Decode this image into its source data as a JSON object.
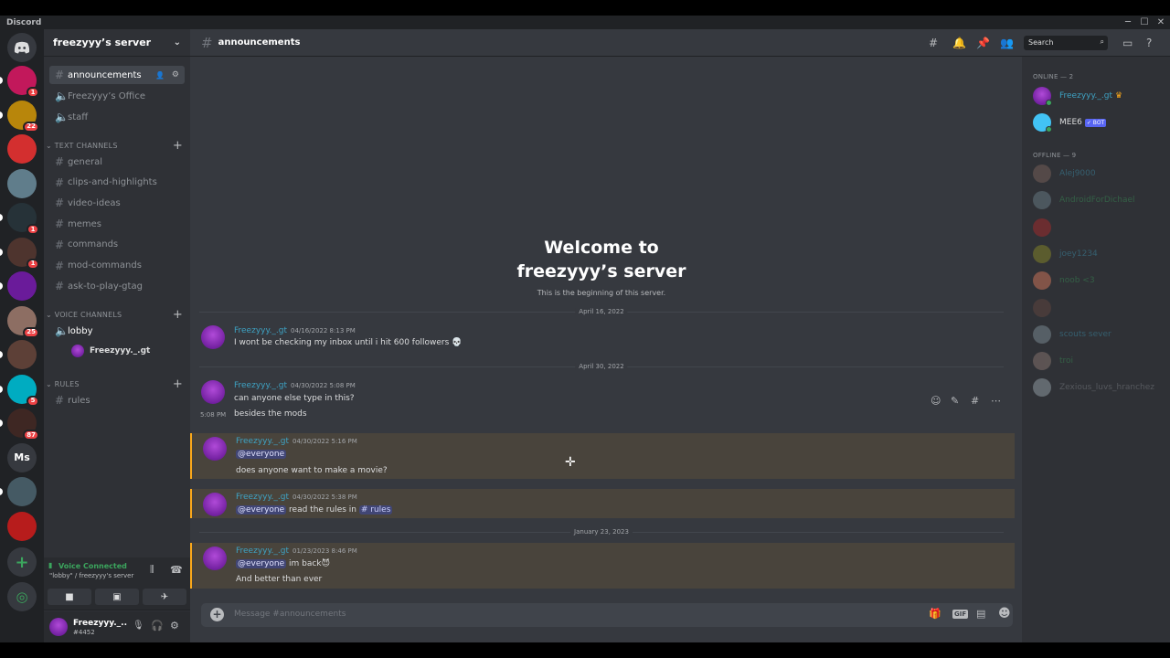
{
  "app": {
    "title": "Discord"
  },
  "server": {
    "name": "freezyyy’s server"
  },
  "guilds": [
    {
      "badge": "1"
    },
    {
      "badge": "22"
    },
    {
      "badge": ""
    },
    {
      "badge": ""
    },
    {
      "badge": "1"
    },
    {
      "badge": "1"
    },
    {
      "badge": ""
    },
    {
      "badge": "25"
    },
    {
      "badge": ""
    },
    {
      "badge": "5"
    },
    {
      "badge": "87"
    },
    {
      "label": "Ms",
      "badge": ""
    },
    {
      "badge": ""
    },
    {
      "badge": ""
    }
  ],
  "sidebar": {
    "top_channels": [
      {
        "name": "announcements",
        "type": "text"
      },
      {
        "name": "Freezyyy’s Office",
        "type": "voice"
      },
      {
        "name": "staff",
        "type": "voice"
      }
    ],
    "text_category": "TEXT CHANNELS",
    "text_channels": [
      "general",
      "clips-and-highlights",
      "video-ideas",
      "memes",
      "commands",
      "mod-commands",
      "ask-to-play-gtag"
    ],
    "voice_category": "VOICE CHANNELS",
    "voice_channels": [
      {
        "name": "lobby",
        "users": [
          "Freezyyy._.gt"
        ]
      }
    ],
    "rules_category": "RULES",
    "rules_channels": [
      "rules"
    ]
  },
  "voice_panel": {
    "status": "Voice Connected",
    "location": "\"lobby\" / freezyyy's server"
  },
  "user_panel": {
    "name": "Freezyyy._..",
    "tag": "#4452"
  },
  "channel": {
    "name": "announcements"
  },
  "header": {
    "search_placeholder": "Search"
  },
  "welcome": {
    "title_line1": "Welcome to",
    "title_line2": "freezyyy’s server",
    "subtitle": "This is the beginning of this server."
  },
  "dividers": [
    "April 16, 2022",
    "April 30, 2022",
    "January 23, 2023"
  ],
  "messages": [
    {
      "author": "Freezyyy._.gt",
      "timestamp": "04/16/2022 8:13 PM",
      "lines": [
        "I wont be checking my inbox until i hit 600 followers 💀"
      ]
    },
    {
      "author": "Freezyyy._.gt",
      "timestamp": "04/30/2022 5:08 PM",
      "lines": [
        "can anyone else type in this?",
        "besides the mods"
      ],
      "followup_time": "5:08 PM"
    },
    {
      "author": "Freezyyy._.gt",
      "timestamp": "04/30/2022 5:16 PM",
      "mention": "@everyone",
      "lines": [
        "does anyone want to make a movie?"
      ]
    },
    {
      "author": "Freezyyy._.gt",
      "timestamp": "04/30/2022 5:38 PM",
      "mention": "@everyone",
      "text_after": " read the rules in ",
      "channel_link": "# rules"
    },
    {
      "author": "Freezyyy._.gt",
      "timestamp": "01/23/2023 8:46 PM",
      "mention": "@everyone",
      "text_after": " im back😈",
      "lines": [
        "And better than ever"
      ]
    }
  ],
  "composer": {
    "placeholder": "Message #announcements"
  },
  "members": {
    "online_header": "ONLINE — 2",
    "online": [
      {
        "name": "Freezyyy._.gt",
        "color": "#3ea2c3",
        "crown": true
      },
      {
        "name": "MEE6",
        "color": "#dcddde",
        "bot": "✓ BOT"
      }
    ],
    "offline_header": "OFFLINE — 9",
    "offline": [
      {
        "name": "Alej9000",
        "color": "#3ea2c3"
      },
      {
        "name": "AndroidForDichael",
        "color": "#3ba55d"
      },
      {
        "name": "",
        "color": "#ed4245"
      },
      {
        "name": "joey1234",
        "color": "#3ea2c3"
      },
      {
        "name": "noob <3",
        "color": "#3ba55d"
      },
      {
        "name": "",
        "color": "#ed4245"
      },
      {
        "name": "scouts sever",
        "color": "#3ea2c3"
      },
      {
        "name": "troi",
        "color": "#3ba55d"
      },
      {
        "name": "Zexious_luvs_hranchez",
        "color": "#8e9297"
      }
    ]
  }
}
